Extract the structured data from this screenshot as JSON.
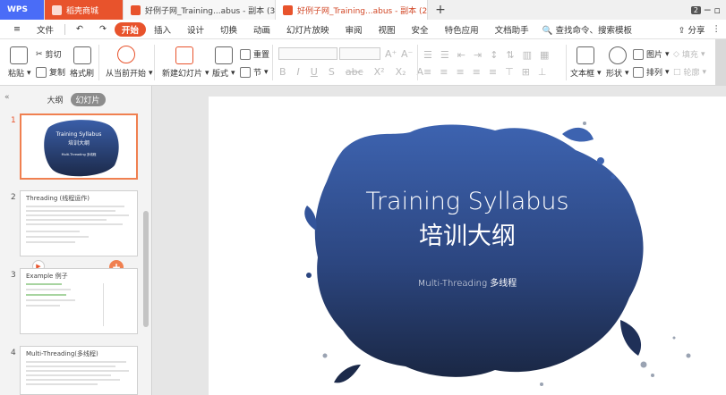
{
  "tabs": {
    "wps": "WPS",
    "store": "稻壳商城",
    "doc1": "好例子网_Training...abus - 副本 (3)",
    "doc2": "好例子网_Training...abus - 副本 (2)",
    "add": "+",
    "badge": "2"
  },
  "menu": {
    "file": "文件",
    "items": [
      "开始",
      "插入",
      "设计",
      "切换",
      "动画",
      "幻灯片放映",
      "审阅",
      "视图",
      "安全",
      "特色应用",
      "文档助手"
    ],
    "search": "查找命令、搜索模板",
    "share": "分享"
  },
  "ribbon": {
    "paste": "粘贴",
    "cut": "剪切",
    "copy": "复制",
    "format_painter": "格式刷",
    "from_current": "从当前开始",
    "new_slide": "新建幻灯片",
    "layout": "版式",
    "reset": "重置",
    "section": "节",
    "textbox": "文本框",
    "shape": "形状",
    "picture": "图片",
    "arrange": "排列",
    "fill": "填充",
    "outline": "轮廓"
  },
  "left_panel": {
    "tab_outline": "大纲",
    "tab_slides": "幻灯片",
    "slides": [
      {
        "num": "1",
        "title": "Training Syllabus",
        "subtitle": "培训大纲",
        "caption": "Multi-Threading 多线程"
      },
      {
        "num": "2",
        "title": "Threading (线程运作)"
      },
      {
        "num": "3",
        "title": "Example 例子"
      },
      {
        "num": "4",
        "title": "Multi-Threading(多线程)"
      }
    ]
  },
  "slide": {
    "title_en": "Training Syllabus",
    "title_cn": "培训大纲",
    "subtitle": "Multi-Threading 多线程"
  },
  "colors": {
    "accent": "#e8532c",
    "wps_blue": "#4a6cf7",
    "splash_top": "#3a5ea8",
    "splash_bottom": "#1c2a4a"
  }
}
